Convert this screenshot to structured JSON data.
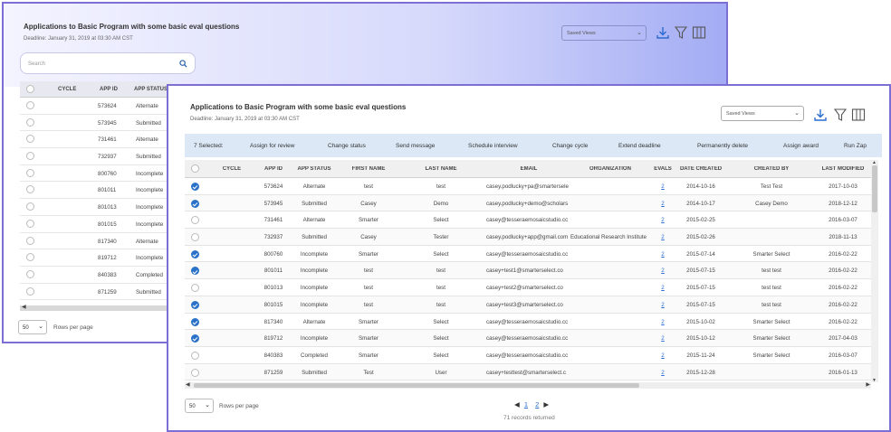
{
  "back_window": {
    "title": "Applications to Basic Program with some basic eval questions",
    "deadline": "Deadline: January 31, 2019 at 03:30 AM CST",
    "search_placeholder": "Search",
    "saved_views": "Saved Views",
    "columns": [
      "CYCLE",
      "APP ID",
      "APP STATUS"
    ],
    "rows": [
      {
        "app_id": "573624",
        "status": "Alternate"
      },
      {
        "app_id": "573945",
        "status": "Submitted"
      },
      {
        "app_id": "731461",
        "status": "Alternate"
      },
      {
        "app_id": "732937",
        "status": "Submitted"
      },
      {
        "app_id": "800760",
        "status": "Incomplete"
      },
      {
        "app_id": "801011",
        "status": "Incomplete"
      },
      {
        "app_id": "801013",
        "status": "Incomplete"
      },
      {
        "app_id": "801015",
        "status": "Incomplete"
      },
      {
        "app_id": "817340",
        "status": "Alternate"
      },
      {
        "app_id": "819712",
        "status": "Incomplete"
      },
      {
        "app_id": "840383",
        "status": "Completed"
      },
      {
        "app_id": "871259",
        "status": "Submitted"
      }
    ],
    "rows_per_page_value": "50",
    "rows_per_page_label": "Rows per page"
  },
  "front_window": {
    "title": "Applications to Basic Program with some basic eval questions",
    "deadline": "Deadline: January 31, 2019 at 03:30 AM CST",
    "saved_views": "Saved Views",
    "action_bar": {
      "selected": "7 Selected:",
      "actions": [
        "Assign for review",
        "Change status",
        "Send message",
        "Schedule interview",
        "Change cycle",
        "Extend deadline",
        "Permanently delete",
        "Assign award",
        "Run Zap"
      ]
    },
    "columns": [
      "CYCLE",
      "APP ID",
      "APP STATUS",
      "FIRST NAME",
      "LAST NAME",
      "EMAIL",
      "ORGANIZATION",
      "EVALS",
      "DATE CREATED",
      "CREATED BY",
      "LAST MODIFIED"
    ],
    "rows": [
      {
        "checked": true,
        "app_id": "573624",
        "status": "Alternate",
        "first": "test",
        "last": "test",
        "email": "casey.podlucky+pa@smartersele",
        "org": "",
        "evals": "2",
        "created": "2014-10-16",
        "created_by": "Test Test",
        "modified": "2017-10-03"
      },
      {
        "checked": true,
        "app_id": "573945",
        "status": "Submitted",
        "first": "Casey",
        "last": "Demo",
        "email": "casey.podlucky+demo@scholars",
        "org": "",
        "evals": "2",
        "created": "2014-10-17",
        "created_by": "Casey Demo",
        "modified": "2018-12-12"
      },
      {
        "checked": false,
        "app_id": "731461",
        "status": "Alternate",
        "first": "Smarter",
        "last": "Select",
        "email": "casey@tesseraemosaicstudio.cc",
        "org": "",
        "evals": "2",
        "created": "2015-02-25",
        "created_by": "",
        "modified": "2016-03-07"
      },
      {
        "checked": false,
        "app_id": "732937",
        "status": "Submitted",
        "first": "Casey",
        "last": "Tester",
        "email": "casey.podlucky+app@gmail.com",
        "org": "Educational Research Institute",
        "evals": "2",
        "created": "2015-02-26",
        "created_by": "",
        "modified": "2018-11-13"
      },
      {
        "checked": true,
        "app_id": "800760",
        "status": "Incomplete",
        "first": "Smarter",
        "last": "Select",
        "email": "casey@tesseraemosaicstudio.cc",
        "org": "",
        "evals": "2",
        "created": "2015-07-14",
        "created_by": "Smarter Select",
        "modified": "2016-02-22"
      },
      {
        "checked": true,
        "app_id": "801011",
        "status": "Incomplete",
        "first": "test",
        "last": "test",
        "email": "casey+test1@smarterselect.co",
        "org": "",
        "evals": "2",
        "created": "2015-07-15",
        "created_by": "test test",
        "modified": "2016-02-22"
      },
      {
        "checked": false,
        "app_id": "801013",
        "status": "Incomplete",
        "first": "test",
        "last": "test",
        "email": "casey+test2@smarterselect.co",
        "org": "",
        "evals": "2",
        "created": "2015-07-15",
        "created_by": "test test",
        "modified": "2016-02-22"
      },
      {
        "checked": true,
        "app_id": "801015",
        "status": "Incomplete",
        "first": "test",
        "last": "test",
        "email": "casey+test3@smarterselect.co",
        "org": "",
        "evals": "2",
        "created": "2015-07-15",
        "created_by": "test test",
        "modified": "2016-02-22"
      },
      {
        "checked": true,
        "app_id": "817340",
        "status": "Alternate",
        "first": "Smarter",
        "last": "Select",
        "email": "casey@tesseraemosaicstudio.cc",
        "org": "",
        "evals": "2",
        "created": "2015-10-02",
        "created_by": "Smarter Select",
        "modified": "2016-02-22"
      },
      {
        "checked": true,
        "app_id": "819712",
        "status": "Incomplete",
        "first": "Smarter",
        "last": "Select",
        "email": "casey@tesseraemosaicstudio.cc",
        "org": "",
        "evals": "2",
        "created": "2015-10-12",
        "created_by": "Smarter Select",
        "modified": "2017-04-03"
      },
      {
        "checked": false,
        "app_id": "840383",
        "status": "Completed",
        "first": "Smarter",
        "last": "Select",
        "email": "casey@tesseraemosaicstudio.cc",
        "org": "",
        "evals": "2",
        "created": "2015-11-24",
        "created_by": "Smarter Select",
        "modified": "2016-03-07"
      },
      {
        "checked": false,
        "app_id": "871259",
        "status": "Submitted",
        "first": "Test",
        "last": "User",
        "email": "casey+testtest@smarterselect.c",
        "org": "",
        "evals": "2",
        "created": "2015-12-28",
        "created_by": "",
        "modified": "2016-01-13"
      }
    ],
    "rows_per_page_value": "50",
    "rows_per_page_label": "Rows per page",
    "pagination": {
      "pages": [
        "1",
        "2"
      ]
    },
    "records_returned": "71 records returned"
  },
  "icons": [
    "download-icon",
    "filter-icon",
    "columns-icon",
    "search-icon"
  ],
  "colors": {
    "accent": "#2a72c8",
    "frame": "#7b6fd6",
    "action_bar": "#dce8f6"
  }
}
